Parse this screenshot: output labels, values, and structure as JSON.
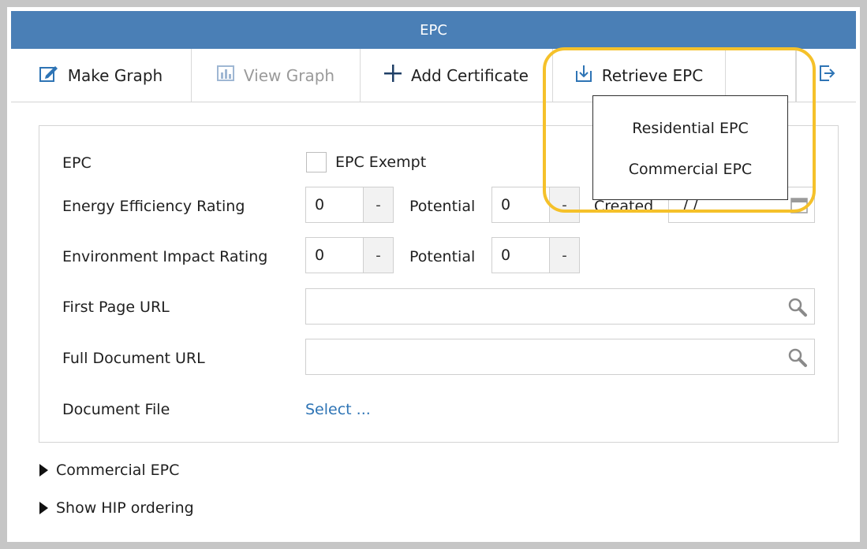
{
  "window": {
    "title": "EPC"
  },
  "toolbar": {
    "make_graph": "Make Graph",
    "view_graph": "View Graph",
    "add_certificate": "Add Certificate",
    "retrieve_epc": "Retrieve EPC"
  },
  "dropdown": {
    "items": [
      "Residential EPC",
      "Commercial EPC"
    ]
  },
  "form": {
    "epc_label": "EPC",
    "epc_exempt_label": "EPC Exempt",
    "energy_label": "Energy Efficiency Rating",
    "energy_value": "0",
    "energy_step": "-",
    "potential_label": "Potential",
    "energy_potential_value": "0",
    "created_label": "Created",
    "created_value": "/ /",
    "environment_label": "Environment Impact Rating",
    "environment_value": "0",
    "environment_potential_value": "0",
    "first_page_url_label": "First Page URL",
    "full_document_url_label": "Full Document URL",
    "document_file_label": "Document File",
    "select_link": "Select ..."
  },
  "expanders": {
    "commercial_epc": "Commercial EPC",
    "show_hip_ordering": "Show HIP ordering"
  },
  "colors": {
    "titlebar": "#4a7fb6",
    "highlight": "#f5c12a",
    "link": "#2e74b5"
  }
}
